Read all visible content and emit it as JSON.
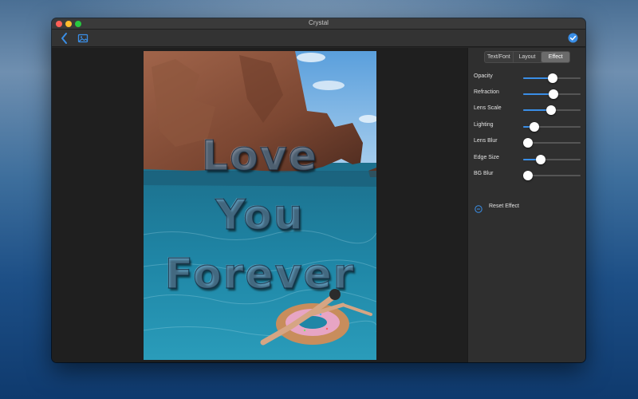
{
  "window": {
    "title": "Crystal"
  },
  "toolbar": {
    "back_icon": "chevron-left-icon",
    "photo_icon": "photo-icon",
    "done_icon": "checkmark-circle-icon",
    "accent": "#3a8ee6"
  },
  "canvas": {
    "text_lines": [
      "Love",
      "You",
      "Forever"
    ]
  },
  "tabs": [
    {
      "label": "Text/Font",
      "active": false
    },
    {
      "label": "Layout",
      "active": false
    },
    {
      "label": "Effect",
      "active": true
    }
  ],
  "controls": [
    {
      "label": "Opacity",
      "value": 0.52
    },
    {
      "label": "Refraction",
      "value": 0.53
    },
    {
      "label": "Lens Scale",
      "value": 0.49
    },
    {
      "label": "Lighting",
      "value": 0.2
    },
    {
      "label": "Lens Blur",
      "value": 0.08
    },
    {
      "label": "Edge Size",
      "value": 0.3
    },
    {
      "label": "BG Blur",
      "value": 0.08
    }
  ],
  "reset": {
    "label": "Reset Effect"
  }
}
